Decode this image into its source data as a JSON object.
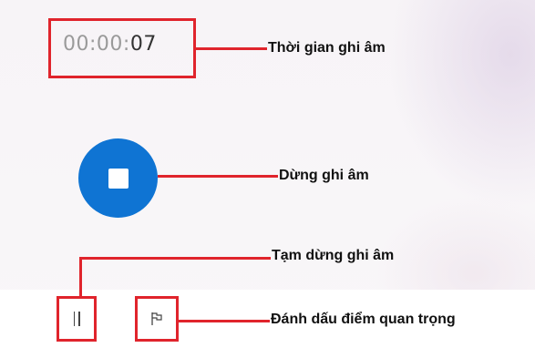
{
  "recorder": {
    "timer": {
      "hh": "00",
      "mm": "00",
      "ss": "07",
      "sep": ":"
    },
    "stop_button": {
      "icon": "stop-icon"
    },
    "pause_button": {
      "icon": "pause-icon"
    },
    "flag_button": {
      "icon": "flag-icon"
    },
    "accent_color": "#0f74d3"
  },
  "annotations": {
    "timer_label": "Thời gian ghi âm",
    "stop_label": "Dừng ghi âm",
    "pause_label": "Tạm dừng ghi âm",
    "flag_label": "Đánh dấu điểm quan trọng",
    "color": "#e0242c"
  }
}
